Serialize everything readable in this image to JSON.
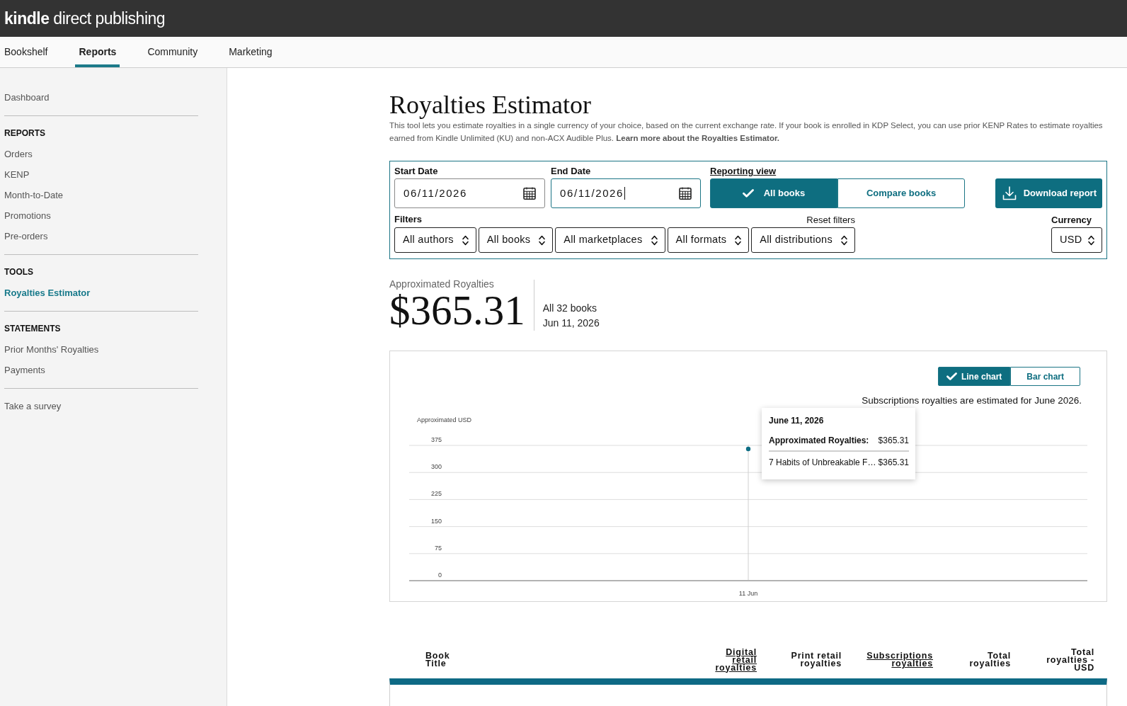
{
  "header": {
    "logo": "**kindle** direct publishing"
  },
  "nav": {
    "tabs": [
      {
        "label": "Bookshelf",
        "selected": false
      },
      {
        "label": "Reports",
        "selected": true
      },
      {
        "label": "Community",
        "selected": false
      },
      {
        "label": "Marketing",
        "selected": false
      }
    ]
  },
  "sidebar": {
    "groups": [
      {
        "items": [
          {
            "label": "Dashboard",
            "selected": false
          }
        ]
      },
      {
        "heading": "REPORTS",
        "items": [
          {
            "label": "Orders",
            "selected": false
          },
          {
            "label": "KENP",
            "selected": false
          },
          {
            "label": "Month-to-Date",
            "selected": false
          },
          {
            "label": "Promotions",
            "selected": false
          },
          {
            "label": "Pre-orders",
            "selected": false
          }
        ]
      },
      {
        "heading": "TOOLS",
        "items": [
          {
            "label": "Royalties Estimator",
            "selected": true
          }
        ]
      },
      {
        "heading": "STATEMENTS",
        "items": [
          {
            "label": "Prior Months' Royalties",
            "selected": false
          },
          {
            "label": "Payments",
            "selected": false
          }
        ]
      },
      {
        "items": [
          {
            "label": "Take a survey",
            "selected": false
          }
        ]
      }
    ]
  },
  "page": {
    "title": "Royalties Estimator",
    "description": "This tool lets you estimate royalties in a single currency of your choice, based on the current exchange rate. If your book is enrolled in KDP Select, you can use prior KENP Rates to estimate royalties earned from Kindle Unlimited (KU) and non-ACX Audible Plus.",
    "learn_more_link": "Learn more about the Royalties Estimator."
  },
  "form": {
    "start_date": {
      "label": "Start Date",
      "value": "06/11/2026",
      "focused": false
    },
    "end_date": {
      "label": "End Date",
      "value": "06/11/2026",
      "focused": true
    },
    "reporting_view": {
      "label": "Reporting view",
      "options": [
        {
          "label": "All books",
          "selected": true
        },
        {
          "label": "Compare books",
          "selected": false
        }
      ]
    },
    "download_button": "Download report",
    "filters_label": "Filters",
    "reset_filters": "Reset filters",
    "filters": [
      "All authors",
      "All books",
      "All marketplaces",
      "All formats",
      "All distributions"
    ],
    "currency": {
      "label": "Currency",
      "value": "USD"
    }
  },
  "summary": {
    "label": "Approximated Royalties",
    "amount": "$365.31",
    "books": "All 32 books",
    "date": "Jun 11, 2026"
  },
  "chart_panel": {
    "chart_types": [
      {
        "label": "Line chart",
        "selected": true
      },
      {
        "label": "Bar chart",
        "selected": false
      }
    ],
    "note": {
      "text": "Subscriptions royalties are estimated for",
      "link": "June 2026",
      "end": "."
    },
    "chart_data": {
      "type": "line",
      "ylabel": "Approximated USD",
      "categories": [
        "11 Jun"
      ],
      "series": [
        {
          "color": "#0e6e85",
          "marker": "circle",
          "values": [
            365.31
          ]
        }
      ],
      "ylim": [
        0,
        375
      ],
      "yticks": [
        0,
        75,
        150,
        225,
        300,
        375
      ],
      "grid": true,
      "ref_lines": [
        {
          "axis": "x",
          "value": "11 Jun",
          "color": "#d0d0d0"
        }
      ]
    },
    "tooltip": {
      "title": "June 11, 2026",
      "rows": [
        {
          "kind": "total",
          "label": "Approximated Royalties:",
          "value": "$365.31"
        },
        {
          "kind": "book",
          "label": "7 Habits of Unbreakable F…",
          "value": "$365.31"
        }
      ]
    }
  },
  "table": {
    "columns": [
      {
        "label": "Book Title",
        "kind": "plain"
      },
      {
        "label": "Digital retail royalties",
        "kind": "link"
      },
      {
        "label": "Print retail royalties",
        "kind": "plain"
      },
      {
        "label": "Subscriptions royalties",
        "kind": "link"
      },
      {
        "label": "Total royalties",
        "kind": "plain"
      },
      {
        "label": "Total royalties - USD",
        "kind": "plain"
      }
    ]
  }
}
